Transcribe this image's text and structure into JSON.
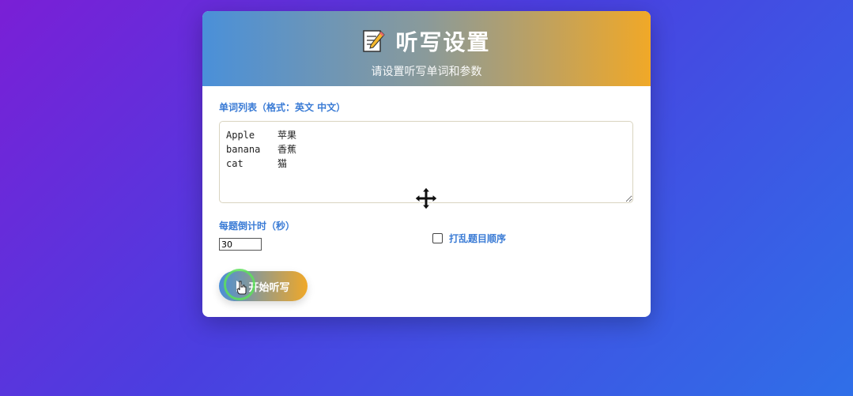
{
  "header": {
    "title": "听写设置",
    "subtitle": "请设置听写单词和参数",
    "icon": "memo-icon"
  },
  "word_list": {
    "label": "单词列表（格式：英文 中文）",
    "value": "Apple    苹果\nbanana   香蕉\ncat      猫"
  },
  "countdown": {
    "label": "每题倒计时（秒）",
    "value": "30"
  },
  "shuffle": {
    "label": "打乱题目顺序",
    "checked": false
  },
  "start_button": {
    "label": "开始听写"
  },
  "colors": {
    "header_gradient_start": "#4a90d9",
    "header_gradient_end": "#f0a828",
    "label": "#3a7bd5"
  }
}
